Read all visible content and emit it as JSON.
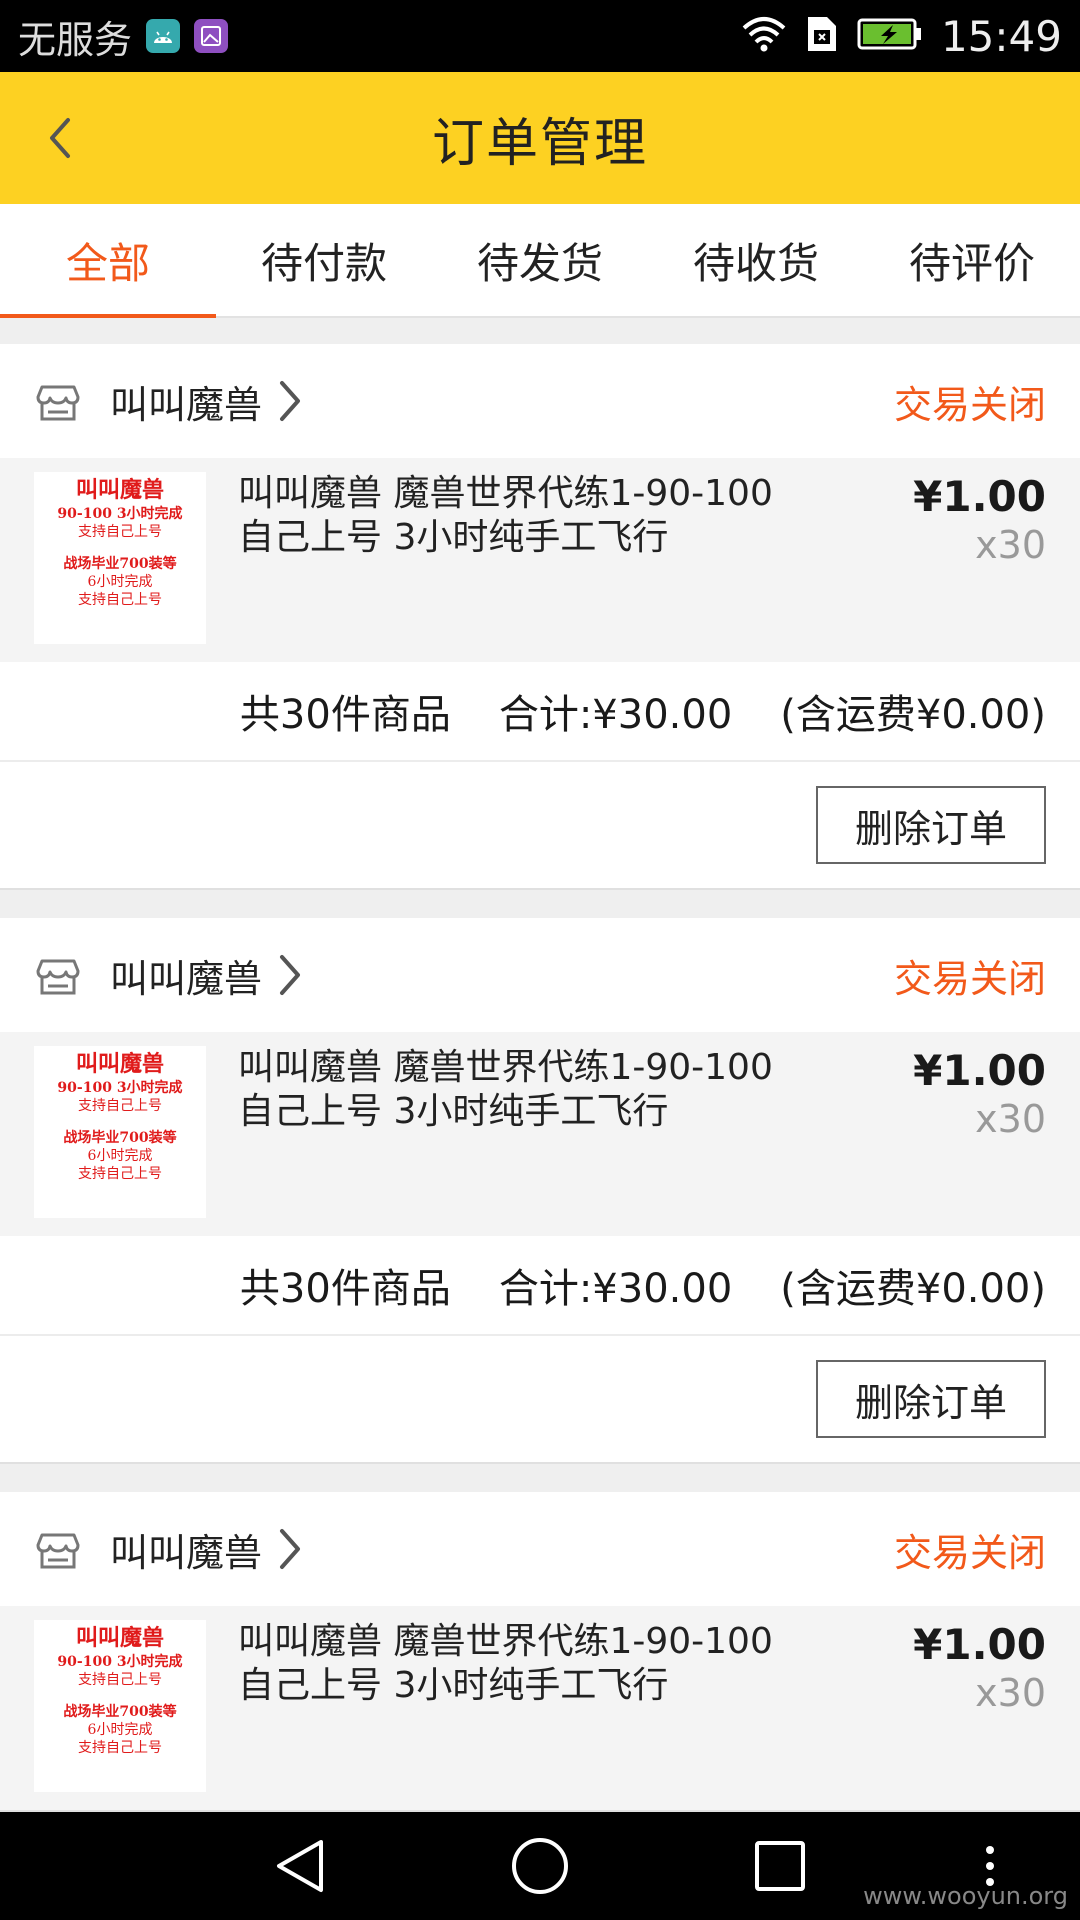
{
  "status_bar": {
    "carrier": "无服务",
    "time": "15:49",
    "icons": [
      "android-icon",
      "gallery-icon",
      "wifi-icon",
      "sim-icon",
      "battery-charging-icon"
    ]
  },
  "header": {
    "title": "订单管理"
  },
  "tabs": [
    {
      "label": "全部",
      "active": true
    },
    {
      "label": "待付款",
      "active": false
    },
    {
      "label": "待发货",
      "active": false
    },
    {
      "label": "待收货",
      "active": false
    },
    {
      "label": "待评价",
      "active": false
    }
  ],
  "orders": [
    {
      "store": "叫叫魔兽",
      "status": "交易关闭",
      "product": {
        "title": "叫叫魔兽 魔兽世界代练1-90-100自己上号 3小时纯手工飞行",
        "price": "¥1.00",
        "qty": "x30",
        "thumb_lines": [
          "叫叫魔兽",
          "90-100 3小时完成",
          "支持自己上号",
          "战场毕业700装等",
          "6小时完成",
          "支持自己上号"
        ]
      },
      "summary": {
        "count": "共30件商品",
        "total": "合计:¥30.00",
        "shipping": "(含运费¥0.00)"
      },
      "action": "删除订单"
    },
    {
      "store": "叫叫魔兽",
      "status": "交易关闭",
      "product": {
        "title": "叫叫魔兽 魔兽世界代练1-90-100自己上号 3小时纯手工飞行",
        "price": "¥1.00",
        "qty": "x30",
        "thumb_lines": [
          "叫叫魔兽",
          "90-100 3小时完成",
          "支持自己上号",
          "战场毕业700装等",
          "6小时完成",
          "支持自己上号"
        ]
      },
      "summary": {
        "count": "共30件商品",
        "total": "合计:¥30.00",
        "shipping": "(含运费¥0.00)"
      },
      "action": "删除订单"
    },
    {
      "store": "叫叫魔兽",
      "status": "交易关闭",
      "product": {
        "title": "叫叫魔兽 魔兽世界代练1-90-100自己上号 3小时纯手工飞行",
        "price": "¥1.00",
        "qty": "x30",
        "thumb_lines": [
          "叫叫魔兽",
          "90-100 3小时完成",
          "支持自己上号",
          "战场毕业700装等",
          "6小时完成",
          "支持自己上号"
        ]
      }
    }
  ],
  "watermark": "www.wooyun.org"
}
